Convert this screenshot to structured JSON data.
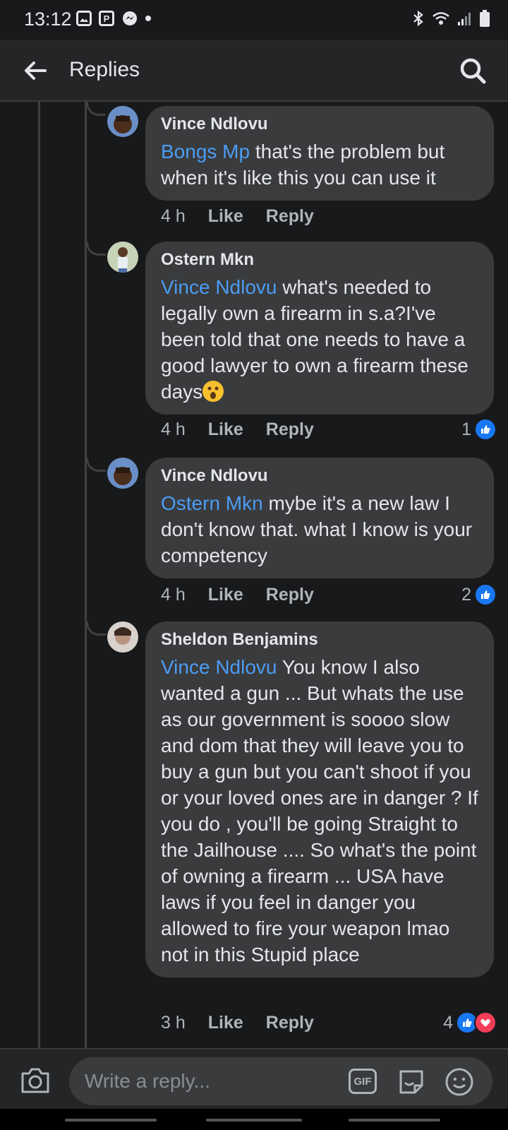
{
  "status_bar": {
    "time": "13:12",
    "icons": [
      "image-icon",
      "p-icon",
      "messenger-icon",
      "dot-icon",
      "bluetooth-icon",
      "wifi-icon",
      "signal-icon",
      "battery-icon"
    ],
    "p_label": "P"
  },
  "header": {
    "title": "Replies"
  },
  "comments": [
    {
      "author": "Vince Ndlovu",
      "mention": "Bongs Mp",
      "text": " that's the problem but when it's like this you can use it",
      "age": "4 h",
      "like": "Like",
      "reply": "Reply",
      "reaction_count": ""
    },
    {
      "author": "Ostern Mkn",
      "mention": "Vince Ndlovu",
      "text": " what's needed to legally own a firearm in s.a?I've been told that one needs to have a good lawyer to own a firearm these days",
      "age": "4 h",
      "like": "Like",
      "reply": "Reply",
      "reaction_count": "1"
    },
    {
      "author": "Vince Ndlovu",
      "mention": "Ostern Mkn",
      "text": " mybe it's a new law I don't know that. what I know is your competency",
      "age": "4 h",
      "like": "Like",
      "reply": "Reply",
      "reaction_count": "2"
    },
    {
      "author": "Sheldon Benjamins",
      "mention": "Vince Ndlovu",
      "text": " You know I also wanted a gun ... But whats the use as our government is soooo slow and dom that they will leave you to buy a gun but you can't shoot if you or your loved ones are in danger ? If you do , you'll be going Straight to the Jailhouse .... So what's the point of owning a firearm ... USA have laws if you feel in danger you allowed to fire your weapon lmao not in this Stupid place",
      "age": "3 h",
      "like": "Like",
      "reply": "Reply",
      "reaction_count": "4"
    }
  ],
  "reply_bar": {
    "placeholder": "Write a reply...",
    "gif_label": "GIF"
  },
  "colors": {
    "background": "#18191a",
    "bubble": "#3a3b3c",
    "mention": "#4b9cf4",
    "like": "#1877f2",
    "love": "#f33e58"
  }
}
